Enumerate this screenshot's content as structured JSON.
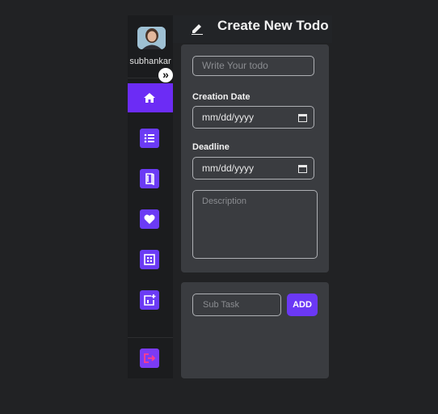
{
  "user": {
    "name": "subhankar"
  },
  "sidebar": {
    "expand_icon": "»",
    "items": [
      {
        "icon": "home-icon",
        "active": true
      },
      {
        "icon": "list-icon",
        "active": false
      },
      {
        "icon": "book-icon",
        "active": false
      },
      {
        "icon": "heart-icon",
        "active": false
      },
      {
        "icon": "grid-icon",
        "active": false
      },
      {
        "icon": "calendar-plus-icon",
        "active": false
      }
    ],
    "logout_icon": "logout-icon"
  },
  "header": {
    "title": "Create New Todo",
    "icon": "edit-icon"
  },
  "form": {
    "todo_placeholder": "Write Your todo",
    "creation_label": "Creation Date",
    "creation_value": "mm/dd/yyyy",
    "deadline_label": "Deadline",
    "deadline_value": "mm/dd/yyyy",
    "description_placeholder": "Description"
  },
  "subtask": {
    "placeholder": "Sub Task",
    "add_label": "ADD"
  },
  "colors": {
    "accent": "#6c2cf5",
    "card": "#3a3c40",
    "background": "#212224"
  }
}
